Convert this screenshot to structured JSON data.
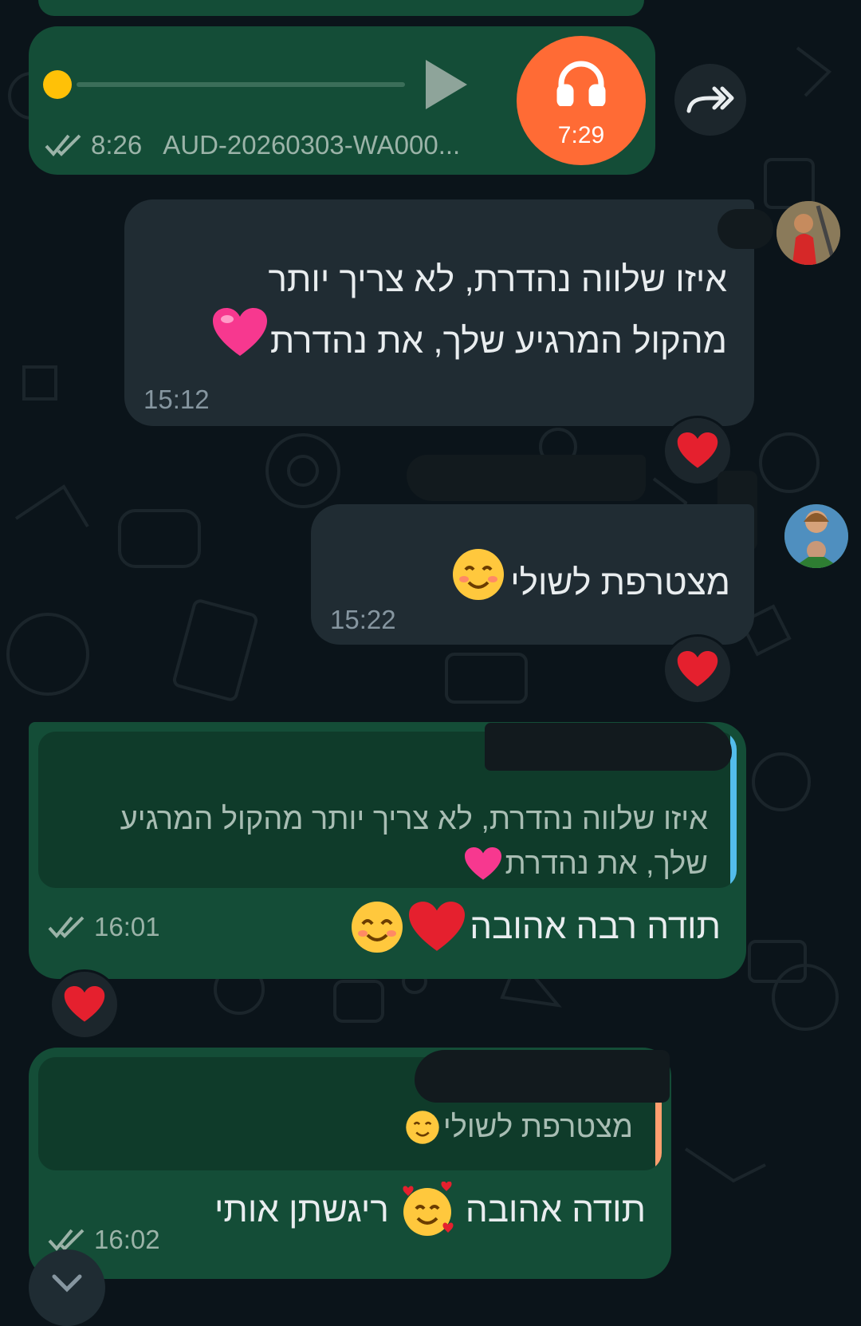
{
  "colors": {
    "background": "#0b141a",
    "outgoing_bubble": "#144d37",
    "incoming_bubble": "#202c33",
    "audio_avatar": "#ff6b35",
    "progress_dot": "#ffc107",
    "quote_bar_blue": "#53bdeb",
    "quote_bar_orange": "#ff9f6e",
    "heart": "#e5202e"
  },
  "audio_message": {
    "duration": "7:29",
    "time": "8:26",
    "filename": "AUD-20260303-WA000...",
    "progress": 0.0,
    "icons": [
      "play-icon",
      "headphones-icon",
      "double-check-icon",
      "forward-icon"
    ]
  },
  "messages": [
    {
      "direction": "incoming",
      "lines": [
        "איזו שלווה נהדרת, לא צריך יותר",
        "מהקול המרגיע שלך, את נהדרת"
      ],
      "trailing_emoji": "pink-heart",
      "time": "15:12",
      "reaction": "red-heart"
    },
    {
      "direction": "incoming",
      "lines": [
        "מצטרפת לשולי"
      ],
      "trailing_emoji": "smiling-face",
      "time": "15:22",
      "reaction": "red-heart"
    },
    {
      "direction": "outgoing",
      "quote_lines": [
        "איזו שלווה נהדרת, לא צריך יותר מהקול המרגיע",
        "שלך, את נהדרת"
      ],
      "lines": [
        "תודה רבה אהובה"
      ],
      "trailing_emojis": [
        "red-heart",
        "smiling-eyes-face"
      ],
      "time": "16:01",
      "reaction": "red-heart"
    },
    {
      "direction": "outgoing",
      "quote_lines": [
        "מצטרפת לשולי"
      ],
      "lines": [
        "תודה אהובה",
        "ריגשתן אותי"
      ],
      "trailing_emoji": "smiling-face-with-hearts",
      "time": "16:02"
    }
  ]
}
